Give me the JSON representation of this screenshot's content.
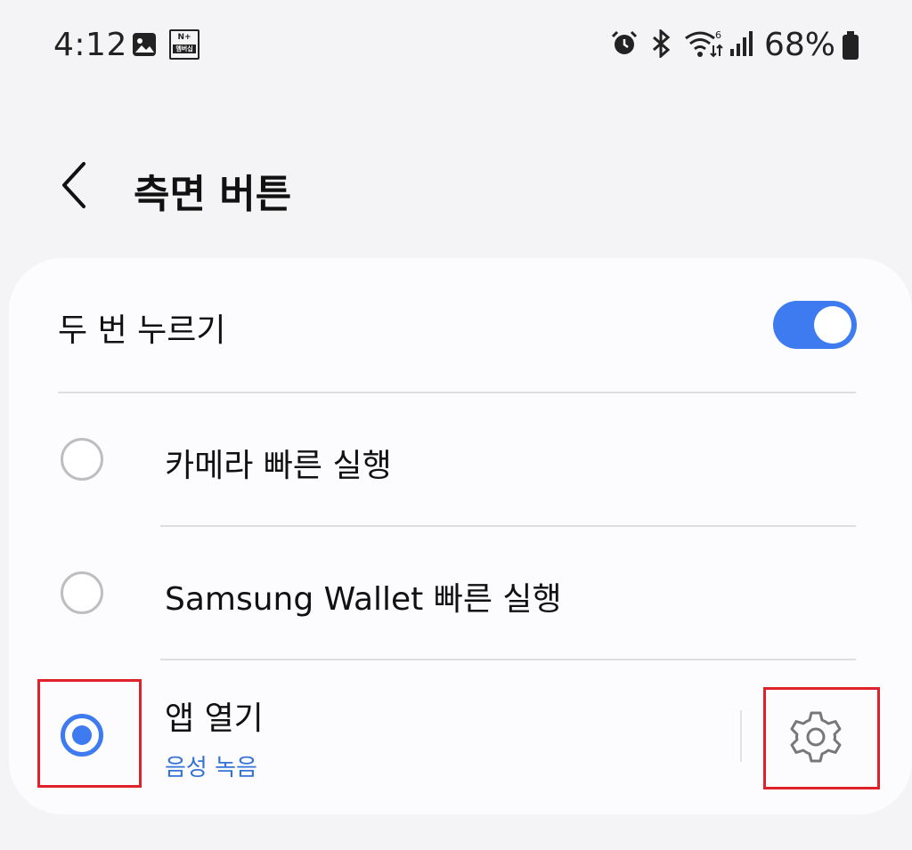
{
  "status_bar": {
    "time": "4:12",
    "badge_top": "N+",
    "badge_bottom": "멤버십",
    "battery_percent": "68%",
    "icons": [
      "gallery-icon",
      "naver-plus-membership-icon",
      "alarm-icon",
      "bluetooth-icon",
      "wifi-icon",
      "signal-icon",
      "battery-icon"
    ]
  },
  "header": {
    "title": "측면 버튼",
    "back_icon": "chevron-left-icon"
  },
  "settings": {
    "double_press": {
      "label": "두 번 누르기",
      "enabled": true
    },
    "options": [
      {
        "label": "카메라 빠른 실행",
        "selected": false
      },
      {
        "label": "Samsung Wallet 빠른 실행",
        "selected": false
      },
      {
        "label": "앱 열기",
        "sublabel": "음성 녹음",
        "selected": true
      }
    ],
    "settings_icon": "gear-icon"
  },
  "colors": {
    "accent": "#3e7bf0",
    "sublabel": "#3572d6",
    "highlight_box": "#e0202a",
    "background": "#f4f4f6",
    "card": "#fcfcfe"
  }
}
